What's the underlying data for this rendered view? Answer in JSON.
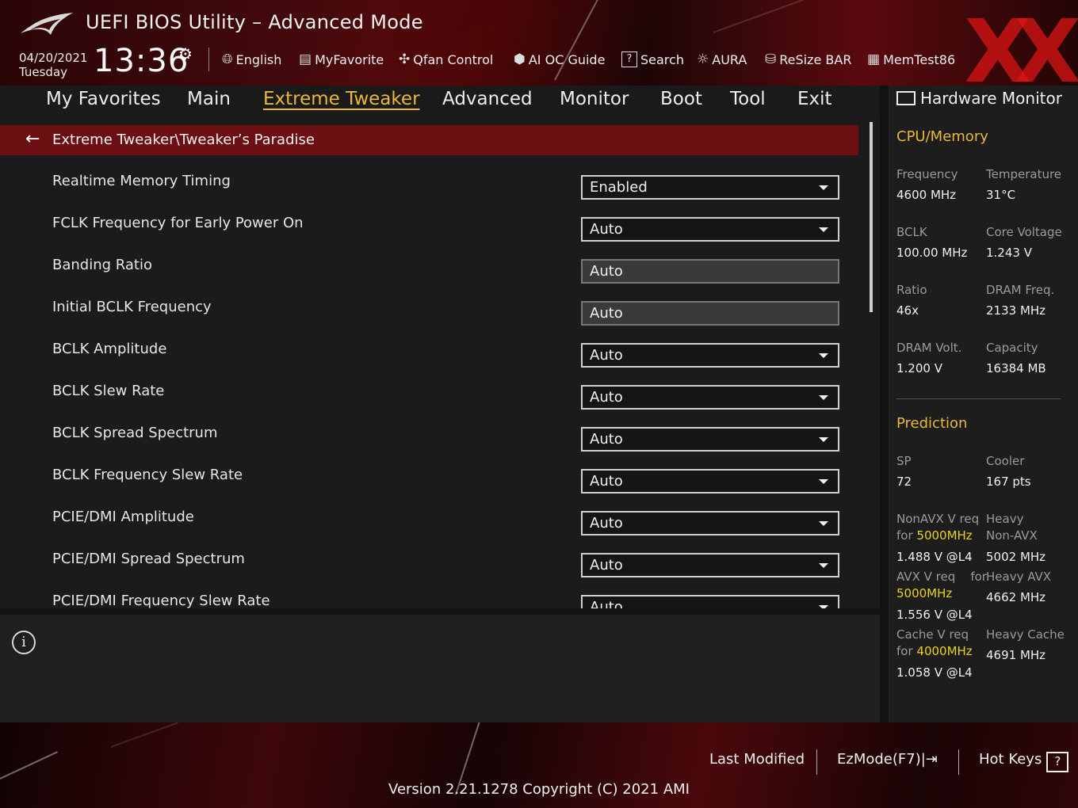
{
  "header": {
    "title": "UEFI BIOS Utility – Advanced Mode",
    "date": "04/20/2021",
    "day": "Tuesday",
    "time": "13:36",
    "toolbar": [
      {
        "label": "English",
        "icon": "globe-icon"
      },
      {
        "label": "MyFavorite",
        "icon": "favorite-icon"
      },
      {
        "label": "Qfan Control",
        "icon": "fan-icon"
      },
      {
        "label": "AI OC Guide",
        "icon": "ai-icon"
      },
      {
        "label": "Search",
        "icon": "search-icon"
      },
      {
        "label": "AURA",
        "icon": "aura-icon"
      },
      {
        "label": "ReSize BAR",
        "icon": "resize-bar-icon"
      },
      {
        "label": "MemTest86",
        "icon": "memtest-icon"
      }
    ]
  },
  "tabs": [
    "My Favorites",
    "Main",
    "Extreme Tweaker",
    "Advanced",
    "Monitor",
    "Boot",
    "Tool",
    "Exit"
  ],
  "active_tab": "Extreme Tweaker",
  "breadcrumb": "Extreme Tweaker\\Tweaker’s Paradise",
  "settings": [
    {
      "label": "Realtime Memory Timing",
      "value": "Enabled",
      "editable": true
    },
    {
      "label": "FCLK Frequency for Early Power On",
      "value": "Auto",
      "editable": true
    },
    {
      "label": "Banding Ratio",
      "value": "Auto",
      "editable": false
    },
    {
      "label": "Initial BCLK Frequency",
      "value": "Auto",
      "editable": false
    },
    {
      "label": "BCLK Amplitude",
      "value": "Auto",
      "editable": true
    },
    {
      "label": "BCLK Slew Rate",
      "value": "Auto",
      "editable": true
    },
    {
      "label": "BCLK Spread Spectrum",
      "value": "Auto",
      "editable": true
    },
    {
      "label": "BCLK Frequency Slew Rate",
      "value": "Auto",
      "editable": true
    },
    {
      "label": "PCIE/DMI Amplitude",
      "value": "Auto",
      "editable": true
    },
    {
      "label": "PCIE/DMI Spread Spectrum",
      "value": "Auto",
      "editable": true
    },
    {
      "label": "PCIE/DMI Frequency Slew Rate",
      "value": "Auto",
      "editable": true
    }
  ],
  "hardware_monitor": {
    "title": "Hardware Monitor",
    "cpu_memory": {
      "heading": "CPU/Memory",
      "frequency_label": "Frequency",
      "frequency": "4600 MHz",
      "temperature_label": "Temperature",
      "temperature": "31°C",
      "bclk_label": "BCLK",
      "bclk": "100.00 MHz",
      "core_voltage_label": "Core Voltage",
      "core_voltage": "1.243 V",
      "ratio_label": "Ratio",
      "ratio": "46x",
      "dram_freq_label": "DRAM Freq.",
      "dram_freq": "2133 MHz",
      "dram_volt_label": "DRAM Volt.",
      "dram_volt": "1.200 V",
      "capacity_label": "Capacity",
      "capacity": "16384 MB"
    },
    "prediction": {
      "heading": "Prediction",
      "sp_label": "SP",
      "sp": "72",
      "cooler_label": "Cooler",
      "cooler": "167 pts",
      "nonavx_label_a": "NonAVX V req",
      "nonavx_label_b": "for",
      "nonavx_freq": "5000MHz",
      "nonavx_v": "1.488 V @L4",
      "heavy_nonavx_label_a": "Heavy",
      "heavy_nonavx_label_b": "Non-AVX",
      "heavy_nonavx": "5002 MHz",
      "avx_label_a": "AVX V req",
      "avx_label_b": "for",
      "avx_freq": "5000MHz",
      "avx_v": "1.556 V @L4",
      "heavy_avx_label": "Heavy AVX",
      "heavy_avx": "4662 MHz",
      "cache_label_a": "Cache V req",
      "cache_label_b": "for",
      "cache_freq": "4000MHz",
      "cache_v": "1.058 V @L4",
      "heavy_cache_label": "Heavy Cache",
      "heavy_cache": "4691 MHz"
    }
  },
  "footer": {
    "last_modified": "Last Modified",
    "ezmode": "EzMode(F7)|",
    "hot_keys": "Hot Keys",
    "hot_keys_key": "?",
    "version": "Version 2.21.1278 Copyright (C) 2021 AMI"
  },
  "colors": {
    "accent": "#e9b83a",
    "breadcrumb_bg": "#6b0f12",
    "highlight_freq": "#e9d21a"
  }
}
